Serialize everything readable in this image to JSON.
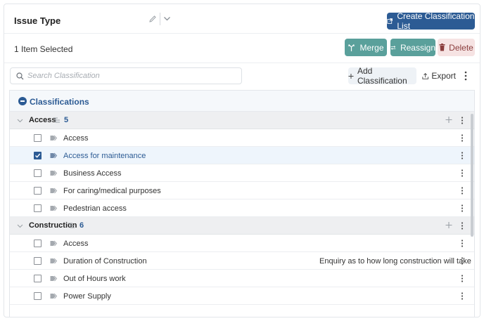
{
  "header": {
    "title": "Issue Type",
    "create_button": "Create Classification List"
  },
  "selection": {
    "status": "1 Item Selected",
    "merge_label": "Merge",
    "reassign_label": "Reassign",
    "delete_label": "Delete"
  },
  "toolbar": {
    "search_placeholder": "Search Classification",
    "add_label": "Add Classification",
    "export_label": "Export"
  },
  "classifications": {
    "title": "Classifications",
    "groups": [
      {
        "name": "Access",
        "count": "5",
        "items": [
          {
            "label": "Access",
            "checked": false,
            "description": ""
          },
          {
            "label": "Access for maintenance",
            "checked": true,
            "description": ""
          },
          {
            "label": "Business Access",
            "checked": false,
            "description": ""
          },
          {
            "label": "For caring/medical purposes",
            "checked": false,
            "description": ""
          },
          {
            "label": "Pedestrian access",
            "checked": false,
            "description": ""
          }
        ]
      },
      {
        "name": "Construction",
        "count": "6",
        "items": [
          {
            "label": "Access",
            "checked": false,
            "description": ""
          },
          {
            "label": "Duration of Construction",
            "checked": false,
            "description": "Enquiry as to how long construction will take"
          },
          {
            "label": "Out of Hours work",
            "checked": false,
            "description": ""
          },
          {
            "label": "Power Supply",
            "checked": false,
            "description": ""
          }
        ]
      }
    ]
  },
  "colors": {
    "primary": "#2c5b94",
    "teal": "#5aa09b",
    "danger_bg": "#f6e3e3",
    "danger_text": "#8a3c3c",
    "selected_row": "#eef5fc"
  }
}
